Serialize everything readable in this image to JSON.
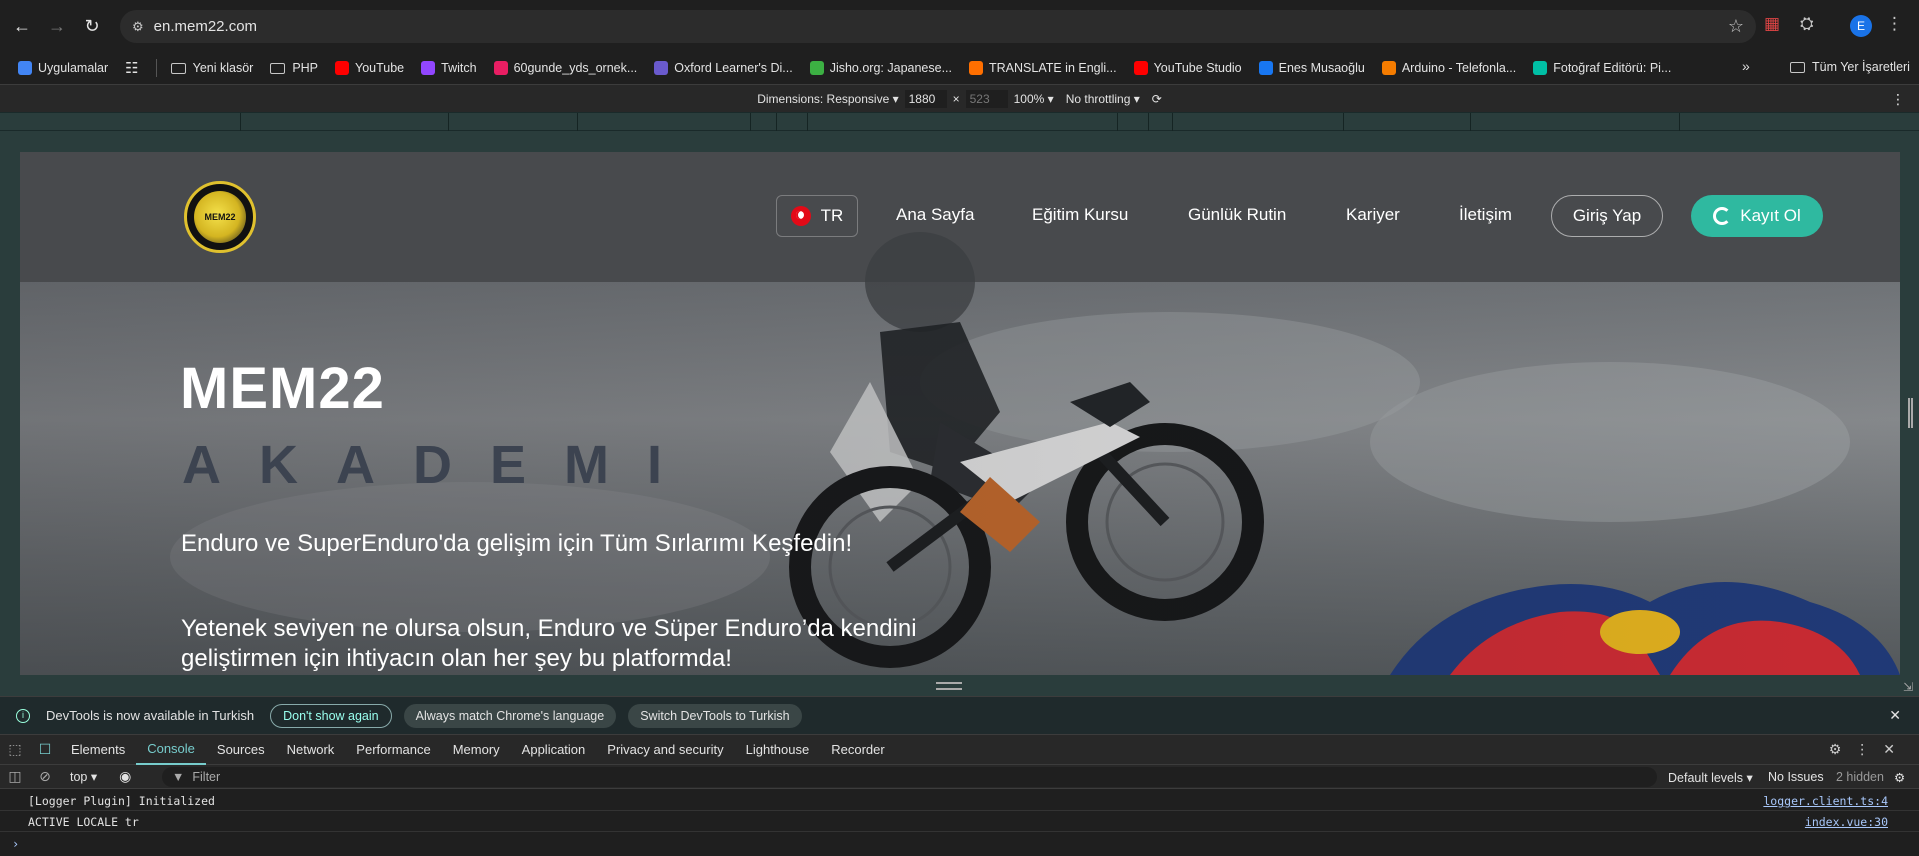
{
  "browser": {
    "url": "en.mem22.com",
    "profile_initial": "E"
  },
  "bookmarks": [
    {
      "label": "Uygulamalar",
      "color": "#4285f4",
      "type": "apps"
    },
    {
      "label": "Yeni klasör",
      "type": "folder"
    },
    {
      "label": "PHP",
      "type": "folder"
    },
    {
      "label": "YouTube",
      "color": "#ff0000"
    },
    {
      "label": "Twitch",
      "color": "#9146ff"
    },
    {
      "label": "60gunde_yds_ornek...",
      "color": "#e91e63"
    },
    {
      "label": "Oxford Learner's Di...",
      "color": "#6a5acd"
    },
    {
      "label": "Jisho.org: Japanese...",
      "color": "#3cb043"
    },
    {
      "label": "TRANSLATE in Engli...",
      "color": "#ff6f00"
    },
    {
      "label": "YouTube Studio",
      "color": "#ff0000"
    },
    {
      "label": "Enes Musaoğlu",
      "color": "#1877f2"
    },
    {
      "label": "Arduino - Telefonla...",
      "color": "#f57c00"
    },
    {
      "label": "Fotoğraf Editörü: Pi...",
      "color": "#00bfa5"
    }
  ],
  "all_bookmarks_label": "Tüm Yer İşaretleri",
  "device_toolbar": {
    "dimensions_label": "Dimensions: Responsive",
    "width": "1880",
    "height": "523",
    "zoom": "100%",
    "throttling": "No throttling"
  },
  "site": {
    "logo_text": "MEM22",
    "lang": "TR",
    "nav": [
      "Ana Sayfa",
      "Eğitim Kursu",
      "Günlük Rutin",
      "Kariyer",
      "İletişim"
    ],
    "login": "Giriş Yap",
    "signup": "Kayıt Ol",
    "hero_title": "MEM22",
    "hero_subtitle": "AKADEMI",
    "hero_p1": "Enduro ve SuperEnduro'da gelişim için Tüm Sırlarımı Keşfedin!",
    "hero_p2": "Yetenek seviyen ne olursa olsun, Enduro ve Süper Enduro’da kendini geliştirmen için ihtiyacın olan her şey bu platformda!"
  },
  "devtools": {
    "info_message": "DevTools is now available in Turkish",
    "dont_show": "Don't show again",
    "always_match": "Always match Chrome's language",
    "switch_turkish": "Switch DevTools to Turkish",
    "tabs": [
      "Elements",
      "Console",
      "Sources",
      "Network",
      "Performance",
      "Memory",
      "Application",
      "Privacy and security",
      "Lighthouse",
      "Recorder"
    ],
    "active_tab": "Console",
    "context": "top",
    "filter_placeholder": "Filter",
    "levels": "Default levels",
    "issues": "No Issues",
    "hidden": "2 hidden",
    "logs": [
      {
        "message": "[Logger Plugin] Initialized",
        "source": "logger.client.ts:4"
      },
      {
        "message": "ACTIVE LOCALE tr",
        "source": "index.vue:30"
      }
    ]
  }
}
